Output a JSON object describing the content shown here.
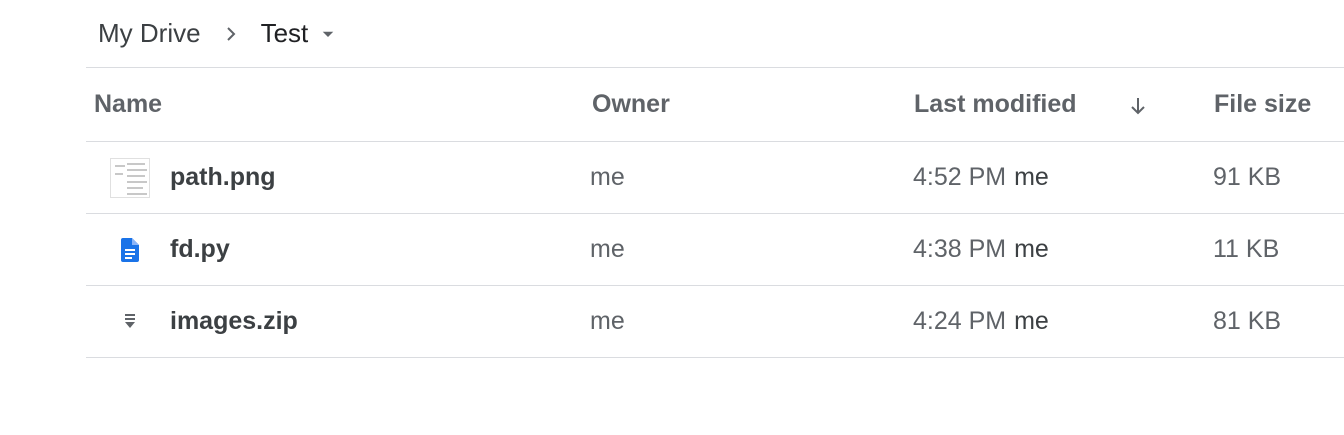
{
  "breadcrumb": {
    "root": "My Drive",
    "current": "Test",
    "separator_icon": "chevron-right-icon",
    "dropdown_icon": "caret-down-icon"
  },
  "columns": {
    "name": "Name",
    "owner": "Owner",
    "last_modified": "Last modified",
    "file_size": "File size",
    "sort_icon": "arrow-down-icon"
  },
  "files": [
    {
      "name": "path.png",
      "icon": "image-thumbnail-icon",
      "owner": "me",
      "modified_time": "4:52 PM",
      "modified_by": "me",
      "size": "91 KB"
    },
    {
      "name": "fd.py",
      "icon": "document-icon",
      "owner": "me",
      "modified_time": "4:38 PM",
      "modified_by": "me",
      "size": "11 KB"
    },
    {
      "name": "images.zip",
      "icon": "archive-icon",
      "owner": "me",
      "modified_time": "4:24 PM",
      "modified_by": "me",
      "size": "81 KB"
    }
  ],
  "colors": {
    "doc_icon": "#1a73e8",
    "archive_icon": "#5f6368",
    "divider": "#dadce0"
  }
}
